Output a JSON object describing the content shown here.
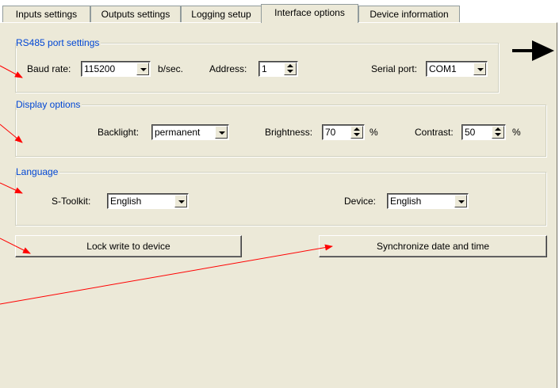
{
  "tabs": [
    {
      "label": "Inputs settings"
    },
    {
      "label": "Outputs settings"
    },
    {
      "label": "Logging setup"
    },
    {
      "label": "Interface options"
    },
    {
      "label": "Device information"
    }
  ],
  "active_tab": "Interface options",
  "rs485": {
    "title": "RS485 port settings",
    "baud_label": "Baud rate:",
    "baud_value": "115200",
    "baud_unit": "b/sec.",
    "address_label": "Address:",
    "address_value": "1",
    "serial_label": "Serial port:",
    "serial_value": "COM1"
  },
  "display": {
    "title": "Display options",
    "backlight_label": "Backlight:",
    "backlight_value": "permanent",
    "brightness_label": "Brightness:",
    "brightness_value": "70",
    "brightness_unit": "%",
    "contrast_label": "Contrast:",
    "contrast_value": "50",
    "contrast_unit": "%"
  },
  "language": {
    "title": "Language",
    "toolkit_label": "S-Toolkit:",
    "toolkit_value": "English",
    "device_label": "Device:",
    "device_value": "English"
  },
  "buttons": {
    "lock": "Lock write to device",
    "sync": "Synchronize date and time"
  },
  "annotation_color": "#ff0000"
}
